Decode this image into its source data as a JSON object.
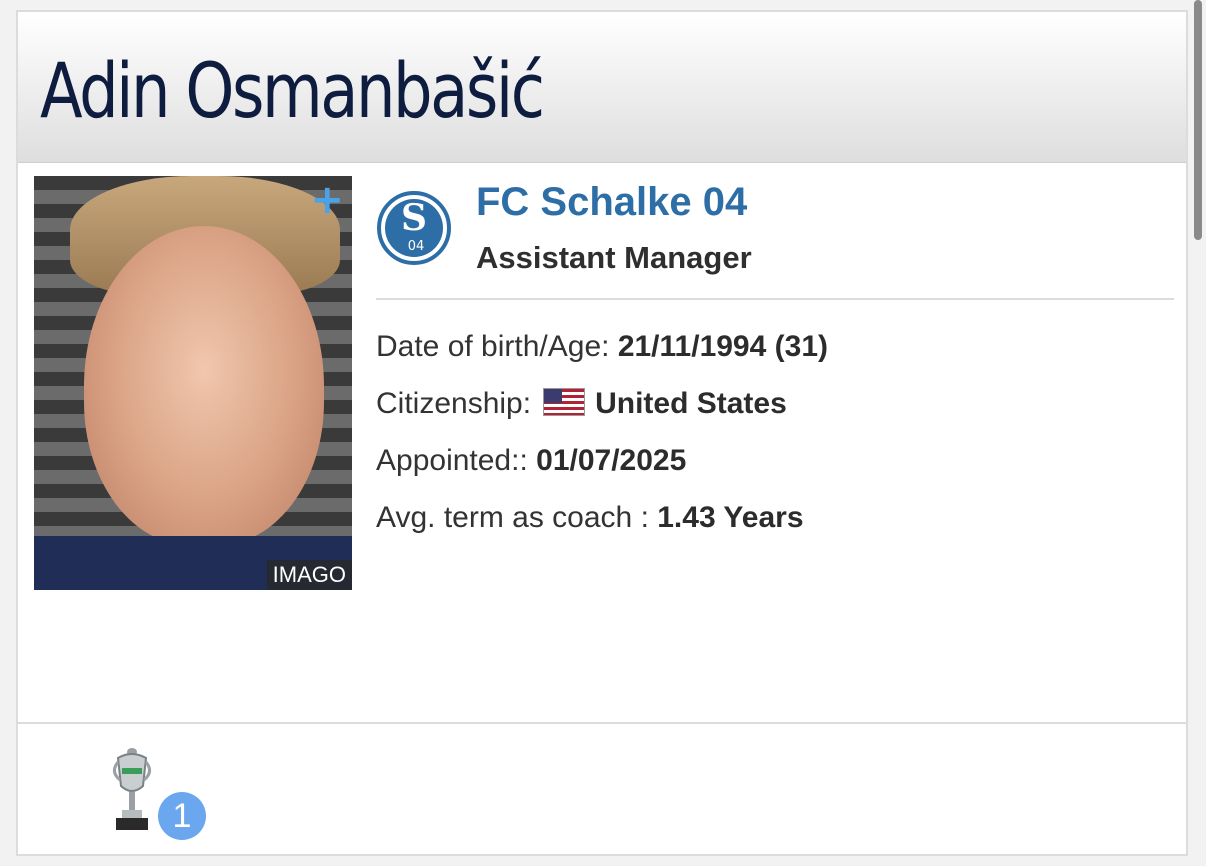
{
  "header": {
    "name": "Adin Osmanbašić"
  },
  "photo": {
    "credit": "IMAGO",
    "expand_icon": "plus-icon"
  },
  "club": {
    "name": "FC Schalke 04",
    "role": "Assistant Manager",
    "logo_icon": "schalke-crest-icon",
    "color": "#2e6ea6"
  },
  "details": {
    "dob_label": "Date of birth/Age:",
    "dob_value": "21/11/1994 (31)",
    "citizenship_label": "Citizenship:",
    "citizenship_value": "United States",
    "appointed_label": "Appointed::",
    "appointed_value": "01/07/2025",
    "term_label": "Avg. term as coach :",
    "term_value": "1.43 Years"
  },
  "trophies": {
    "icon": "trophy-icon",
    "count": "1"
  }
}
